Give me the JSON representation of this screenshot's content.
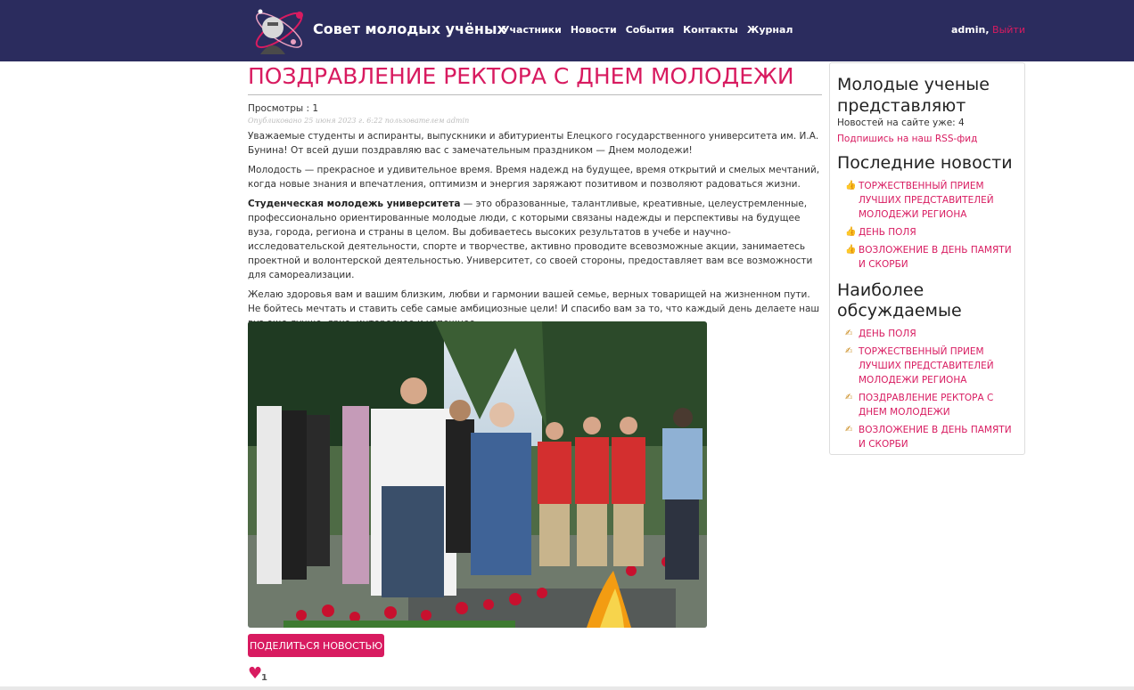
{
  "header": {
    "brand_name": "Совет молодых учёных",
    "nav": [
      "Участники",
      "Новости",
      "События",
      "Контакты",
      "Журнал"
    ],
    "user": "admin,",
    "logout": "Выйти"
  },
  "article": {
    "title": "ПОЗДРАВЛЕНИЕ РЕКТОРА С ДНЕМ МОЛОДЕЖИ",
    "views": "Просмотры : 1",
    "meta": "Опубликовано 25 июня 2023 г. 6:22 пользователем admin",
    "p1": "Уважаемые студенты и аспиранты, выпускники и абитуриенты Елецкого государственного университета им. И.А. Бунина! От всей души поздравляю вас с замечательным праздником — Днем молодежи!",
    "p2": "Молодость — прекрасное и удивительное время. Время надежд на будущее, время открытий и смелых мечтаний, когда новые знания и впечатления, оптимизм и энергия заряжают позитивом и позволяют радоваться жизни.",
    "p3_bold": "Студенческая молодежь университета",
    "p3_rest": " — это образованные, талантливые, креативные, целеустремленные, профессионально ориентированные молодые люди, с которыми связаны надежды и перспективы на будущее вуза, города, региона и страны в целом. Вы добиваетесь высоких результатов в учебе и научно-исследовательской деятельности, спорте и творчестве, активно проводите всевозможные акции, занимаетесь проектной и волонтерской деятельностью. Университет, со своей стороны, предоставляет вам все возможности для самореализации.",
    "p4": "Желаю здоровья вам и вашим близким, любви и гармонии вашей семье, верных товарищей на жизненном пути. Не бойтесь мечтать и ставить себе самые амбициозные цели! И спасибо вам за то, что каждый день делаете наш вуз еще лучше, ярче, интереснее и успешнее.",
    "share_label": "ПОДЕЛИТЬСЯ НОВОСТЬЮ",
    "like_icon": "♥",
    "like_count": "1"
  },
  "sidebar": {
    "title": "Молодые ученые представляют",
    "news_count": "Новостей на сайте уже: 4",
    "rss": "Подпишись на наш RSS-фид",
    "latest_heading": "Последние новости",
    "latest": [
      "ТОРЖЕСТВЕННЫЙ ПРИЕМ ЛУЧШИХ ПРЕДСТАВИТЕЛЕЙ МОЛОДЕЖИ РЕГИОНА",
      "ДЕНЬ ПОЛЯ",
      "ВОЗЛОЖЕНИЕ В ДЕНЬ ПАМЯТИ И СКОРБИ"
    ],
    "popular_heading": "Наиболее обсуждаемые",
    "popular": [
      "ДЕНЬ ПОЛЯ",
      "ТОРЖЕСТВЕННЫЙ ПРИЕМ ЛУЧШИХ ПРЕДСТАВИТЕЛЕЙ МОЛОДЕЖИ РЕГИОНА",
      "ПОЗДРАВЛЕНИЕ РЕКТОРА С ДНЕМ МОЛОДЕЖИ",
      "ВОЗЛОЖЕНИЕ В ДЕНЬ ПАМЯТИ И СКОРБИ"
    ],
    "latest_icon": "thumbs-up-icon",
    "popular_icon": "writing-hand-icon"
  },
  "colors": {
    "navbar": "#2b2c5e",
    "accent": "#d81b60"
  }
}
